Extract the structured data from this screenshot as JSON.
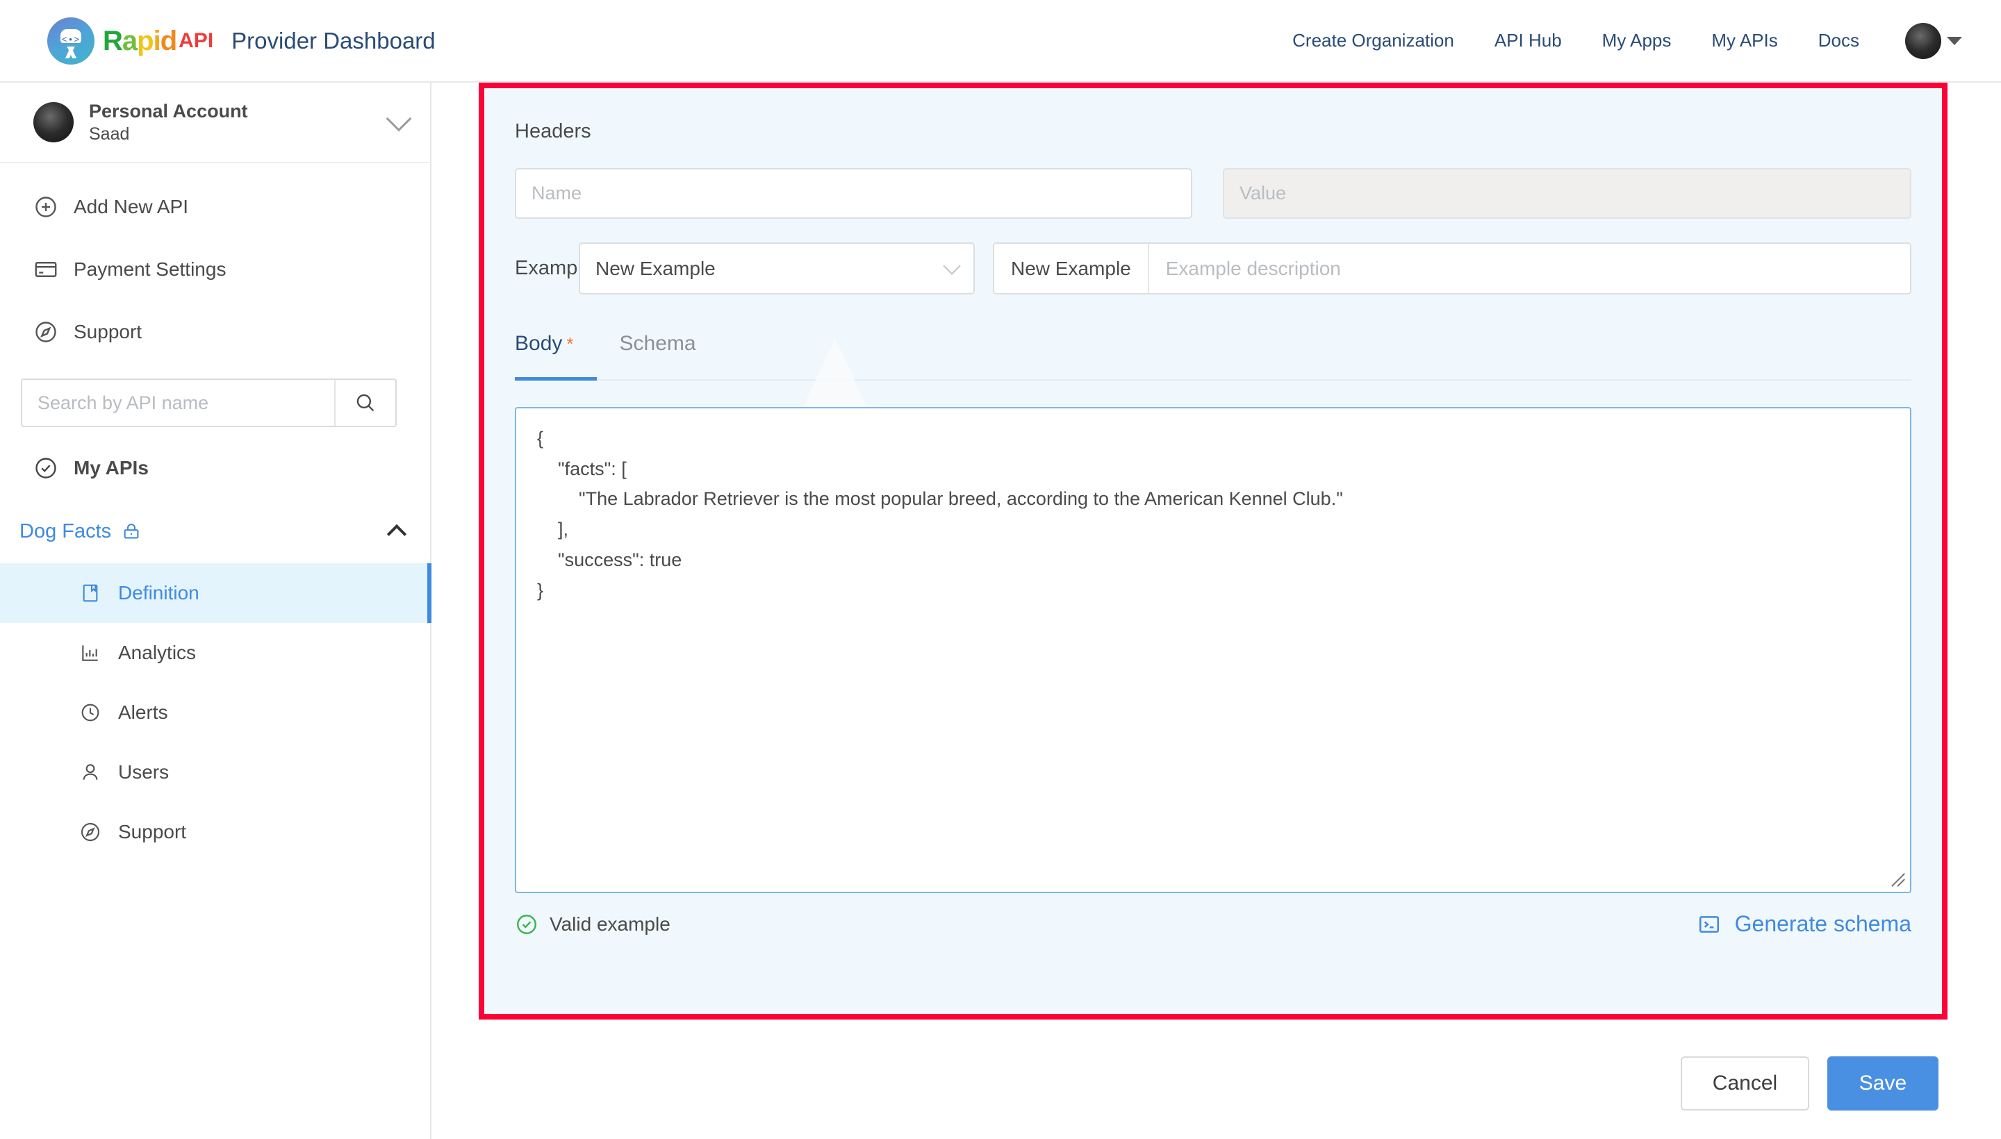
{
  "topbar": {
    "logo_word_letters": [
      "R",
      "a",
      "p",
      "i",
      "d"
    ],
    "logo_api": "API",
    "brand_title": "Provider Dashboard",
    "nav": [
      {
        "label": "Create Organization"
      },
      {
        "label": "API Hub"
      },
      {
        "label": "My Apps"
      },
      {
        "label": "My APIs"
      },
      {
        "label": "Docs"
      }
    ],
    "avatar_icon": "user-avatar",
    "caret_icon": "caret-down-icon"
  },
  "sidebar": {
    "account": {
      "name": "Personal Account",
      "user": "Saad",
      "chevron_icon": "chevron-down-icon"
    },
    "nav_items": [
      {
        "label": "Add New API",
        "icon": "plus-circle-icon"
      },
      {
        "label": "Payment Settings",
        "icon": "credit-card-icon"
      },
      {
        "label": "Support",
        "icon": "compass-icon"
      }
    ],
    "search": {
      "placeholder": "Search by API name",
      "value": "",
      "icon": "search-icon"
    },
    "my_apis": {
      "label": "My APIs",
      "icon": "check-circle-icon"
    },
    "api_group": {
      "name": "Dog Facts",
      "lock_icon": "lock-icon",
      "collapse_icon": "chevron-up-icon"
    },
    "sub_items": [
      {
        "label": "Definition",
        "icon": "book-icon",
        "active": true
      },
      {
        "label": "Analytics",
        "icon": "bar-chart-icon",
        "active": false
      },
      {
        "label": "Alerts",
        "icon": "clock-icon",
        "active": false
      },
      {
        "label": "Users",
        "icon": "person-icon",
        "active": false
      },
      {
        "label": "Support",
        "icon": "compass-icon",
        "active": false
      }
    ]
  },
  "main": {
    "headers_label": "Headers",
    "header_name": {
      "placeholder": "Name",
      "value": ""
    },
    "header_value": {
      "placeholder": "Value",
      "value": "",
      "disabled": true
    },
    "example": {
      "label": "Example",
      "select_value": "New Example",
      "select_arrow_icon": "chevron-down-icon",
      "name_value": "New Example",
      "description_placeholder": "Example description",
      "description_value": ""
    },
    "tabs": [
      {
        "label": "Body",
        "required_mark": "*",
        "active": true
      },
      {
        "label": "Schema",
        "required_mark": "",
        "active": false
      }
    ],
    "body_code": "{\n    \"facts\": [\n        \"The Labrador Retriever is the most popular breed, according to the American Kennel Club.\"\n    ],\n    \"success\": true\n}",
    "validation": {
      "text": "Valid example",
      "icon": "check-circle-icon",
      "color": "#3cb44a"
    },
    "generate_schema": {
      "label": "Generate schema",
      "icon": "terminal-icon",
      "color": "#3f8ae0"
    },
    "buttons": {
      "cancel": "Cancel",
      "save": "Save"
    },
    "highlight_border_color": "#fb0238",
    "panel_background": "#f1f8fd"
  }
}
